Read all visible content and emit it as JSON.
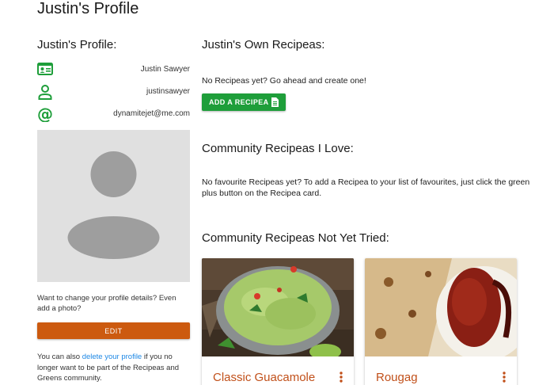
{
  "page": {
    "title": "Justin's Profile"
  },
  "profile": {
    "heading": "Justin's Profile:",
    "name": "Justin Sawyer",
    "username": "justinsawyer",
    "email": "dynamitejet@me.com",
    "change_text": "Want to change your profile details? Even add a photo?",
    "edit_label": "EDIT",
    "delete_prefix": "You can also ",
    "delete_link": "delete your profile",
    "delete_suffix": " if you no longer want to be part of the Recipeas and Greens community."
  },
  "own": {
    "heading": "Justin's Own Recipeas:",
    "empty_text": "No Recipeas yet? Go ahead and create one!",
    "add_label": "ADD A RECIPEA"
  },
  "loved": {
    "heading": "Community Recipeas I Love:",
    "empty_text": "No favourite Recipeas yet? To add a Recipea to your list of favourites, just click the green plus button on the Recipea card."
  },
  "not_tried": {
    "heading": "Community Recipeas Not Yet Tried:",
    "cards": [
      {
        "title": "Classic Guacamole"
      },
      {
        "title": "Rougag"
      }
    ]
  },
  "colors": {
    "accent_green": "#1e9e3a",
    "edit_orange": "#cc5a0f",
    "card_title": "#c1501a",
    "link_blue": "#1e88e5"
  },
  "icons": [
    "id-card-icon",
    "person-icon",
    "at-icon",
    "doc-icon",
    "more-vert-icon"
  ]
}
